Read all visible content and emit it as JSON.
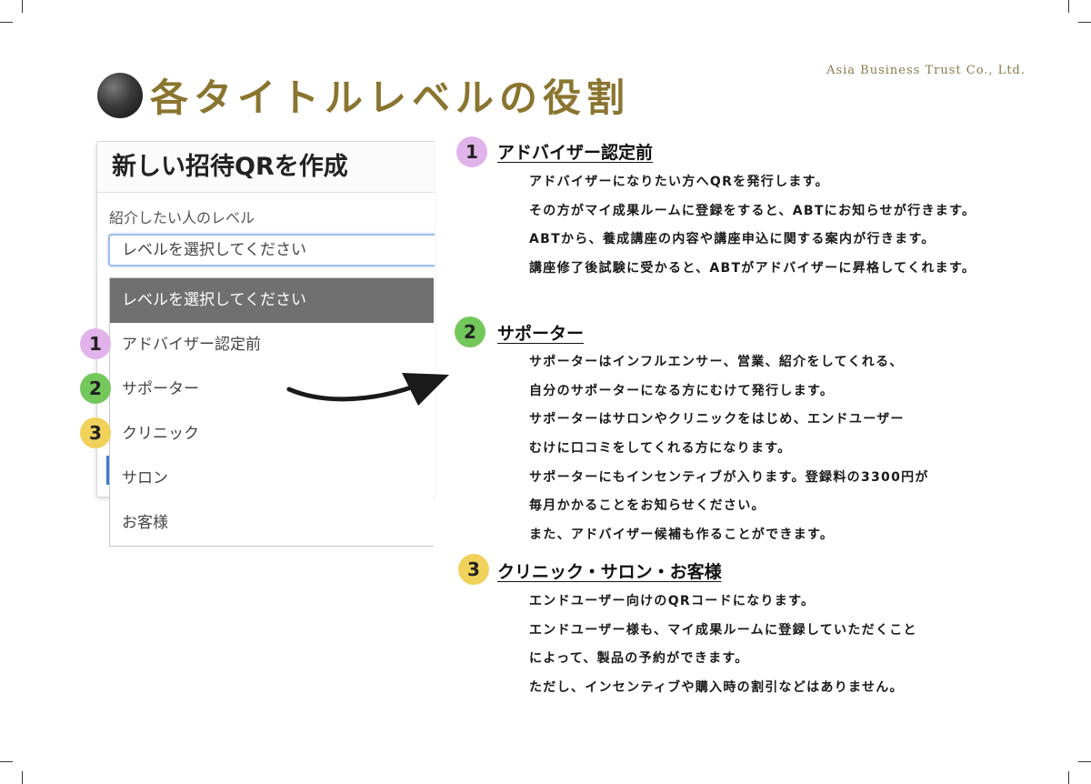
{
  "brand": "Asia Business Trust Co., Ltd.",
  "page_title": "各タイトルレベルの役割",
  "mock_form": {
    "title": "新しい招待QRを作成",
    "field_label": "紹介したい人のレベル",
    "select_value": "レベルを選択してください",
    "dropdown_options": [
      "レベルを選択してください",
      "アドバイザー認定前",
      "サポーター",
      "クリニック",
      "サロン",
      "お客様"
    ],
    "badges": [
      "1",
      "2",
      "3"
    ]
  },
  "sections": [
    {
      "number": "1",
      "heading": "アドバイザー認定前",
      "lines": [
        "アドバイザーになりたい方へQRを発行します。",
        "その方がマイ成果ルームに登録をすると、ABTにお知らせが行きます。",
        "ABTから、養成講座の内容や講座申込に関する案内が行きます。",
        "講座修了後試験に受かると、ABTがアドバイザーに昇格してくれます。"
      ]
    },
    {
      "number": "2",
      "heading": "サポーター",
      "lines": [
        "サポーターはインフルエンサー、営業、紹介をしてくれる、",
        "自分のサポーターになる方にむけて発行します。",
        "サポーターはサロンやクリニックをはじめ、エンドユーザー",
        "むけに口コミをしてくれる方になります。",
        "サポーターにもインセンティブが入ります。登録料の3300円が",
        "毎月かかることをお知らせください。",
        "また、アドバイザー候補も作ることができます。"
      ]
    },
    {
      "number": "3",
      "heading": "クリニック・サロン・お客様",
      "lines": [
        "エンドユーザー向けのQRコードになります。",
        "エンドユーザー様も、マイ成果ルームに登録していただくこと",
        "によって、製品の予約ができます。",
        "ただし、インセンティブや購入時の割引などはありません。"
      ]
    }
  ],
  "colors": {
    "title_gold": "#8a7530",
    "badge_pink": "#e2b3ea",
    "badge_green": "#74c75a",
    "badge_yellow": "#f0d15a",
    "dropdown_selected": "#707070"
  }
}
